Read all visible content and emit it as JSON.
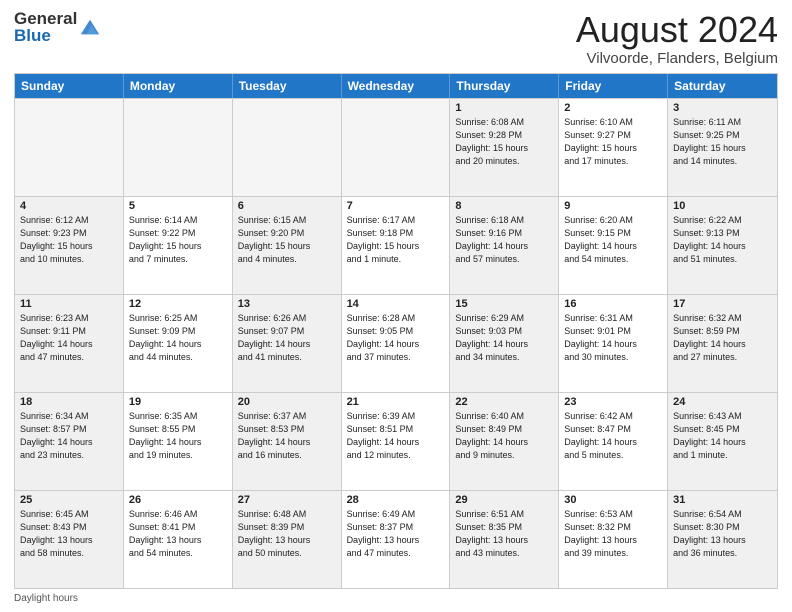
{
  "header": {
    "logo_general": "General",
    "logo_blue": "Blue",
    "month_title": "August 2024",
    "location": "Vilvoorde, Flanders, Belgium"
  },
  "calendar": {
    "days_of_week": [
      "Sunday",
      "Monday",
      "Tuesday",
      "Wednesday",
      "Thursday",
      "Friday",
      "Saturday"
    ],
    "rows": [
      [
        {
          "day": "",
          "detail": "",
          "empty": true
        },
        {
          "day": "",
          "detail": "",
          "empty": true
        },
        {
          "day": "",
          "detail": "",
          "empty": true
        },
        {
          "day": "",
          "detail": "",
          "empty": true
        },
        {
          "day": "1",
          "detail": "Sunrise: 6:08 AM\nSunset: 9:28 PM\nDaylight: 15 hours\nand 20 minutes."
        },
        {
          "day": "2",
          "detail": "Sunrise: 6:10 AM\nSunset: 9:27 PM\nDaylight: 15 hours\nand 17 minutes."
        },
        {
          "day": "3",
          "detail": "Sunrise: 6:11 AM\nSunset: 9:25 PM\nDaylight: 15 hours\nand 14 minutes."
        }
      ],
      [
        {
          "day": "4",
          "detail": "Sunrise: 6:12 AM\nSunset: 9:23 PM\nDaylight: 15 hours\nand 10 minutes."
        },
        {
          "day": "5",
          "detail": "Sunrise: 6:14 AM\nSunset: 9:22 PM\nDaylight: 15 hours\nand 7 minutes."
        },
        {
          "day": "6",
          "detail": "Sunrise: 6:15 AM\nSunset: 9:20 PM\nDaylight: 15 hours\nand 4 minutes."
        },
        {
          "day": "7",
          "detail": "Sunrise: 6:17 AM\nSunset: 9:18 PM\nDaylight: 15 hours\nand 1 minute."
        },
        {
          "day": "8",
          "detail": "Sunrise: 6:18 AM\nSunset: 9:16 PM\nDaylight: 14 hours\nand 57 minutes."
        },
        {
          "day": "9",
          "detail": "Sunrise: 6:20 AM\nSunset: 9:15 PM\nDaylight: 14 hours\nand 54 minutes."
        },
        {
          "day": "10",
          "detail": "Sunrise: 6:22 AM\nSunset: 9:13 PM\nDaylight: 14 hours\nand 51 minutes."
        }
      ],
      [
        {
          "day": "11",
          "detail": "Sunrise: 6:23 AM\nSunset: 9:11 PM\nDaylight: 14 hours\nand 47 minutes."
        },
        {
          "day": "12",
          "detail": "Sunrise: 6:25 AM\nSunset: 9:09 PM\nDaylight: 14 hours\nand 44 minutes."
        },
        {
          "day": "13",
          "detail": "Sunrise: 6:26 AM\nSunset: 9:07 PM\nDaylight: 14 hours\nand 41 minutes."
        },
        {
          "day": "14",
          "detail": "Sunrise: 6:28 AM\nSunset: 9:05 PM\nDaylight: 14 hours\nand 37 minutes."
        },
        {
          "day": "15",
          "detail": "Sunrise: 6:29 AM\nSunset: 9:03 PM\nDaylight: 14 hours\nand 34 minutes."
        },
        {
          "day": "16",
          "detail": "Sunrise: 6:31 AM\nSunset: 9:01 PM\nDaylight: 14 hours\nand 30 minutes."
        },
        {
          "day": "17",
          "detail": "Sunrise: 6:32 AM\nSunset: 8:59 PM\nDaylight: 14 hours\nand 27 minutes."
        }
      ],
      [
        {
          "day": "18",
          "detail": "Sunrise: 6:34 AM\nSunset: 8:57 PM\nDaylight: 14 hours\nand 23 minutes."
        },
        {
          "day": "19",
          "detail": "Sunrise: 6:35 AM\nSunset: 8:55 PM\nDaylight: 14 hours\nand 19 minutes."
        },
        {
          "day": "20",
          "detail": "Sunrise: 6:37 AM\nSunset: 8:53 PM\nDaylight: 14 hours\nand 16 minutes."
        },
        {
          "day": "21",
          "detail": "Sunrise: 6:39 AM\nSunset: 8:51 PM\nDaylight: 14 hours\nand 12 minutes."
        },
        {
          "day": "22",
          "detail": "Sunrise: 6:40 AM\nSunset: 8:49 PM\nDaylight: 14 hours\nand 9 minutes."
        },
        {
          "day": "23",
          "detail": "Sunrise: 6:42 AM\nSunset: 8:47 PM\nDaylight: 14 hours\nand 5 minutes."
        },
        {
          "day": "24",
          "detail": "Sunrise: 6:43 AM\nSunset: 8:45 PM\nDaylight: 14 hours\nand 1 minute."
        }
      ],
      [
        {
          "day": "25",
          "detail": "Sunrise: 6:45 AM\nSunset: 8:43 PM\nDaylight: 13 hours\nand 58 minutes."
        },
        {
          "day": "26",
          "detail": "Sunrise: 6:46 AM\nSunset: 8:41 PM\nDaylight: 13 hours\nand 54 minutes."
        },
        {
          "day": "27",
          "detail": "Sunrise: 6:48 AM\nSunset: 8:39 PM\nDaylight: 13 hours\nand 50 minutes."
        },
        {
          "day": "28",
          "detail": "Sunrise: 6:49 AM\nSunset: 8:37 PM\nDaylight: 13 hours\nand 47 minutes."
        },
        {
          "day": "29",
          "detail": "Sunrise: 6:51 AM\nSunset: 8:35 PM\nDaylight: 13 hours\nand 43 minutes."
        },
        {
          "day": "30",
          "detail": "Sunrise: 6:53 AM\nSunset: 8:32 PM\nDaylight: 13 hours\nand 39 minutes."
        },
        {
          "day": "31",
          "detail": "Sunrise: 6:54 AM\nSunset: 8:30 PM\nDaylight: 13 hours\nand 36 minutes."
        }
      ]
    ]
  },
  "footer": {
    "daylight_label": "Daylight hours"
  }
}
